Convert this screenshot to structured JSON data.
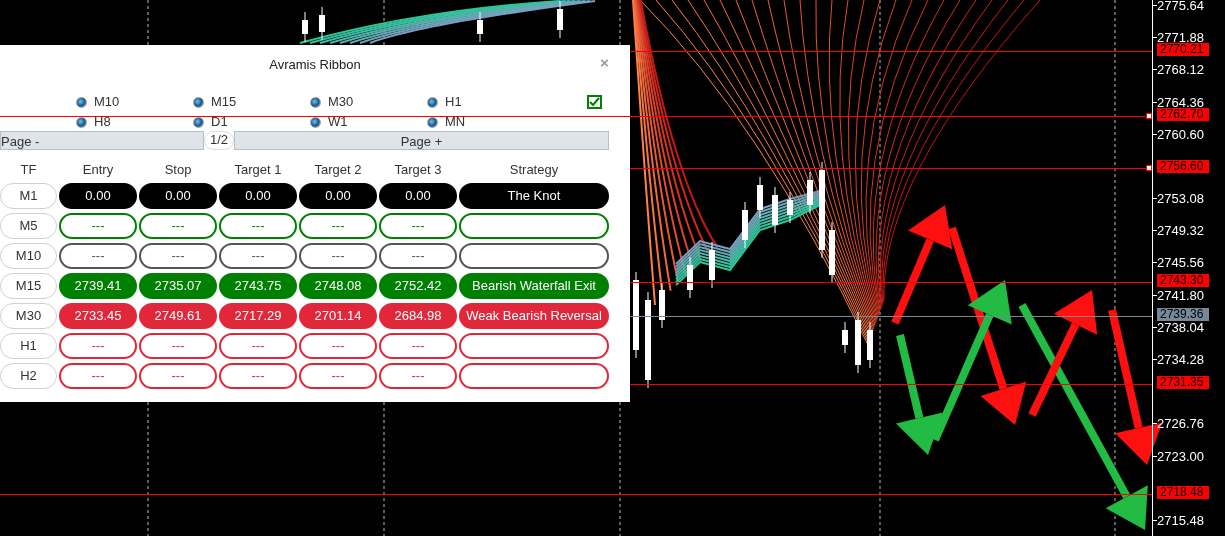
{
  "panel": {
    "title": "Avramis Ribbon",
    "close": "×",
    "timeframes": [
      {
        "label": "M10",
        "selected": true
      },
      {
        "label": "M15",
        "selected": true
      },
      {
        "label": "M30",
        "selected": true
      },
      {
        "label": "H1",
        "selected": true
      },
      {
        "label": "H8",
        "selected": true
      },
      {
        "label": "D1",
        "selected": true
      },
      {
        "label": "W1",
        "selected": true
      },
      {
        "label": "MN",
        "selected": true
      }
    ],
    "checkbox": {
      "checked": true
    },
    "pager": {
      "prev": "Page -",
      "page": "1/2",
      "next": "Page +"
    },
    "table": {
      "columns": [
        "TF",
        "Entry",
        "Stop",
        "Target 1",
        "Target 2",
        "Target 3",
        "Strategy"
      ],
      "rows": [
        {
          "kind": "filled",
          "color": "#000000",
          "cells": [
            "M1",
            "0.00",
            "0.00",
            "0.00",
            "0.00",
            "0.00",
            "The Knot"
          ]
        },
        {
          "kind": "outline",
          "color": "#008000",
          "cells": [
            "M5",
            "---",
            "---",
            "---",
            "---",
            "---",
            ""
          ]
        },
        {
          "kind": "outline",
          "color": "#555555",
          "cells": [
            "M10",
            "---",
            "---",
            "---",
            "---",
            "---",
            ""
          ]
        },
        {
          "kind": "filled",
          "color": "#008000",
          "cells": [
            "M15",
            "2739.41",
            "2735.07",
            "2743.75",
            "2748.08",
            "2752.42",
            "Bearish Waterfall Exit"
          ]
        },
        {
          "kind": "filled",
          "color": "#e0283a",
          "cells": [
            "M30",
            "2733.45",
            "2749.61",
            "2717.29",
            "2701.14",
            "2684.98",
            "Weak Bearish Reversal"
          ]
        },
        {
          "kind": "outline",
          "color": "#e0283a",
          "cells": [
            "H1",
            "---",
            "---",
            "---",
            "---",
            "---",
            ""
          ]
        },
        {
          "kind": "outline",
          "color": "#e0283a",
          "cells": [
            "H2",
            "---",
            "---",
            "---",
            "---",
            "---",
            ""
          ]
        }
      ]
    }
  },
  "chart": {
    "axis_labels": [
      "2775.64",
      "2771.88",
      "2768.12",
      "2764.36",
      "2760.60",
      "2753.08",
      "2749.32",
      "2745.56",
      "2741.80",
      "2738.04",
      "2734.28",
      "2726.76",
      "2723.00",
      "2715.48"
    ],
    "price_lines": [
      {
        "price": "2770.21",
        "color": "#ff0000",
        "marker": false
      },
      {
        "price": "2762.70",
        "color": "#ff0000",
        "marker": true,
        "on_top": true
      },
      {
        "price": "2756.60",
        "color": "#ff0000",
        "marker": true
      },
      {
        "price": "2743.30",
        "color": "#ff0000",
        "marker": false
      },
      {
        "price": "2739.36",
        "color": "#778899",
        "marker": false
      },
      {
        "price": "2731.35",
        "color": "#ff0000",
        "marker": false
      },
      {
        "price": "2718.48",
        "color": "#ff0000",
        "marker": false
      }
    ]
  }
}
